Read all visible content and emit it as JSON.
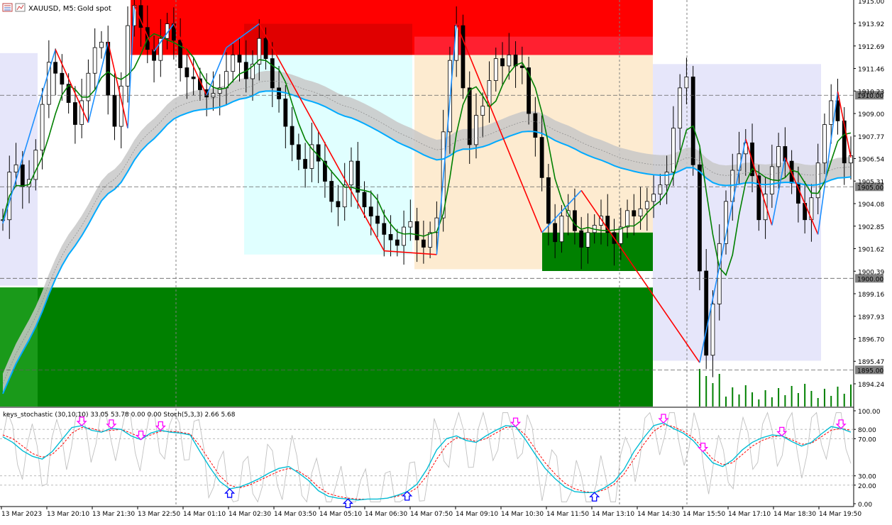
{
  "header": {
    "symbol": "XAUUSD, M5:",
    "description": "Gold spot"
  },
  "colors": {
    "background": "#ffffff",
    "bull_candle": "#000000",
    "bear_candle": "#000000",
    "zigzag_up": "#1e90ff",
    "zigzag_down": "#ff0000",
    "ma_fast": "#008000",
    "ema_cloud": "#c8c8c8",
    "ma_slow_blue": "#00aaff",
    "ma_slow_red": "#ff0000",
    "zone_red": "#ff0000",
    "zone_green": "#008000",
    "zone_cyan": "#e0ffff",
    "zone_tan": "#fdebd0",
    "zone_lavender": "#e6e6fa",
    "stoch_main": "#00bcd4",
    "stoch_signal": "#ff0000",
    "stoch_raw": "#c0c0c0",
    "arrow_down": "#ff00ff",
    "arrow_up": "#0000ff",
    "volume": "#008000"
  },
  "chart_data": [
    {
      "type": "candlestick",
      "name": "XAUUSD M5 price",
      "price_axis": {
        "ticks": [
          "1913.92",
          "1912.69",
          "1911.46",
          "1910.23",
          "1909.00",
          "1907.77",
          "1906.54",
          "1905.31",
          "1904.08",
          "1902.85",
          "1901.62",
          "1900.39",
          "1899.16",
          "1897.93",
          "1896.70",
          "1895.47",
          "1894.24"
        ],
        "tick_values": [
          1913.92,
          1912.69,
          1911.46,
          1910.23,
          1909.0,
          1907.77,
          1906.54,
          1905.31,
          1904.08,
          1902.85,
          1901.62,
          1900.39,
          1899.16,
          1897.93,
          1896.7,
          1895.47,
          1894.24
        ],
        "top_partial_label": "1915.00",
        "ylim": [
          1893.0,
          1915.2
        ],
        "horizontal_levels": [
          {
            "label": "1910.00",
            "value": 1910.0
          },
          {
            "label": "1905.00",
            "value": 1905.0
          },
          {
            "label": "1900.00",
            "value": 1900.0
          },
          {
            "label": "1895.00",
            "value": 1895.0
          }
        ]
      },
      "time_axis": {
        "labels": [
          "13 Mar 2023",
          "13 Mar 20:10",
          "13 Mar 21:30",
          "13 Mar 22:50",
          "14 Mar 01:10",
          "14 Mar 02:30",
          "14 Mar 03:50",
          "14 Mar 05:10",
          "14 Mar 06:30",
          "14 Mar 07:50",
          "14 Mar 09:10",
          "14 Mar 10:30",
          "14 Mar 11:50",
          "14 Mar 13:10",
          "14 Mar 14:30",
          "14 Mar 15:50",
          "14 Mar 17:10",
          "14 Mar 18:30",
          "14 Mar 19:50"
        ]
      },
      "close_series": [
        1903.2,
        1905.8,
        1906.2,
        1905.0,
        1905.4,
        1907.0,
        1909.5,
        1911.8,
        1911.2,
        1910.6,
        1909.6,
        1908.4,
        1909.7,
        1911.2,
        1912.6,
        1912.9,
        1910.0,
        1908.3,
        1910.5,
        1913.8,
        1914.9,
        1913.7,
        1912.5,
        1911.9,
        1913.1,
        1913.9,
        1913.0,
        1911.5,
        1911.0,
        1910.9,
        1910.3,
        1909.9,
        1910.1,
        1910.4,
        1911.3,
        1912.2,
        1911.8,
        1910.9,
        1911.7,
        1913.1,
        1912.0,
        1910.4,
        1909.8,
        1908.3,
        1907.3,
        1906.5,
        1906.0,
        1907.3,
        1906.4,
        1905.3,
        1904.2,
        1903.9,
        1905.1,
        1906.4,
        1904.7,
        1903.9,
        1903.4,
        1903.0,
        1902.4,
        1902.1,
        1901.8,
        1902.8,
        1903.1,
        1902.1,
        1901.7,
        1902.5,
        1903.3,
        1908.0,
        1911.9,
        1913.8,
        1910.4,
        1907.3,
        1908.9,
        1909.4,
        1910.8,
        1912.0,
        1911.6,
        1912.2,
        1911.6,
        1911.5,
        1909.0,
        1907.7,
        1905.5,
        1903.0,
        1902.0,
        1903.4,
        1903.7,
        1902.6,
        1901.7,
        1902.5,
        1902.9,
        1903.4,
        1902.5,
        1901.9,
        1902.8,
        1903.7,
        1903.4,
        1903.8,
        1904.2,
        1904.6,
        1905.1,
        1905.8,
        1908.2,
        1910.4,
        1911.0,
        1906.2,
        1900.4,
        1895.8,
        1898.6,
        1901.9,
        1904.2,
        1905.9,
        1906.8,
        1907.4,
        1905.6,
        1903.2,
        1904.6,
        1906.1,
        1907.2,
        1906.4,
        1905.2,
        1904.1,
        1903.2,
        1904.4,
        1906.3,
        1908.4,
        1909.7,
        1908.6,
        1906.3,
        1906.7
      ]
    },
    {
      "type": "line",
      "name": "keys_stochastic (30,10,10) 33.05 53.78 0.00 0.00 Stoch(5,3,3) 2.66 5.68",
      "ylim": [
        0,
        100
      ],
      "y_ticks": [
        "100.00",
        "80.00",
        "70.00",
        "30.00",
        "20.00",
        "0.00"
      ],
      "y_tick_values": [
        100,
        80,
        70,
        30,
        20,
        0
      ],
      "series": [
        {
          "name": "keys_stochastic main",
          "values": [
            72,
            66,
            57,
            51,
            48,
            56,
            69,
            82,
            84,
            79,
            77,
            81,
            80,
            73,
            69,
            76,
            79,
            77,
            76,
            74,
            56,
            39,
            24,
            16,
            18,
            22,
            27,
            33,
            38,
            40,
            33,
            25,
            14,
            8,
            6,
            5,
            4,
            5,
            5,
            6,
            9,
            13,
            21,
            37,
            58,
            70,
            73,
            68,
            66,
            73,
            79,
            84,
            83,
            69,
            53,
            38,
            27,
            18,
            13,
            12,
            12,
            17,
            24,
            37,
            56,
            71,
            84,
            87,
            81,
            76,
            68,
            56,
            44,
            40,
            47,
            58,
            66,
            71,
            74,
            73,
            67,
            62,
            66,
            75,
            83,
            81,
            77
          ]
        },
        {
          "name": "Stoch signal",
          "values": [
            74,
            70,
            62,
            54,
            50,
            53,
            63,
            76,
            82,
            81,
            78,
            79,
            80,
            76,
            71,
            74,
            78,
            78,
            77,
            75,
            62,
            46,
            30,
            20,
            17,
            20,
            25,
            30,
            35,
            38,
            35,
            28,
            18,
            11,
            8,
            6,
            5,
            5,
            5,
            6,
            8,
            11,
            17,
            30,
            48,
            63,
            71,
            70,
            67,
            70,
            76,
            82,
            83,
            74,
            59,
            44,
            32,
            22,
            16,
            13,
            12,
            15,
            21,
            32,
            48,
            64,
            78,
            85,
            83,
            78,
            71,
            60,
            48,
            42,
            44,
            53,
            62,
            68,
            72,
            73,
            69,
            64,
            65,
            72,
            79,
            81,
            79
          ]
        }
      ],
      "arrows": [
        {
          "dir": "down",
          "index": 8
        },
        {
          "dir": "down",
          "index": 11
        },
        {
          "dir": "down",
          "index": 14
        },
        {
          "dir": "down",
          "index": 16
        },
        {
          "dir": "up",
          "index": 23
        },
        {
          "dir": "up",
          "index": 35
        },
        {
          "dir": "up",
          "index": 41
        },
        {
          "dir": "down",
          "index": 52
        },
        {
          "dir": "up",
          "index": 60
        },
        {
          "dir": "down",
          "index": 67
        },
        {
          "dir": "down",
          "index": 71
        },
        {
          "dir": "down",
          "index": 79
        },
        {
          "dir": "down",
          "index": 85
        }
      ]
    }
  ]
}
